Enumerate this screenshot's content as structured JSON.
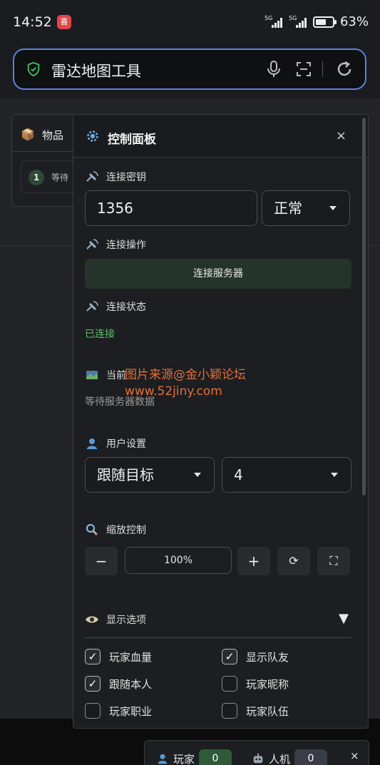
{
  "status_bar": {
    "time": "14:52",
    "notification_badge": "喜",
    "signal_1": "5G",
    "signal_2": "5G",
    "battery": "63%",
    "battery_level": 0.63
  },
  "browser": {
    "search_text": "雷达地图工具"
  },
  "items_panel": {
    "title": "物品",
    "row_number": "1",
    "row_text": "等待"
  },
  "control_panel": {
    "title": "控制面板",
    "close": "×",
    "connection_key": {
      "label": "连接密钥",
      "value": "1356",
      "mode": "正常"
    },
    "connection_action": {
      "label": "连接操作",
      "button": "连接服务器"
    },
    "connection_status": {
      "label": "连接状态",
      "value": "已连接"
    },
    "current": {
      "label": "当前",
      "value": "等待服务器数据"
    },
    "watermark": {
      "line1": "图片来源@金小颖论坛",
      "line2": "www.52jiny.com"
    },
    "user_settings": {
      "label": "用户设置",
      "follow": "跟随目标",
      "number": "4"
    },
    "zoom": {
      "label": "缩放控制",
      "minus": "−",
      "value": "100%",
      "plus": "+",
      "reset": "⟳",
      "fullscreen": "⛶"
    },
    "display_options": {
      "label": "显示选项",
      "toggle": "▼",
      "options": [
        {
          "label": "玩家血量",
          "checked": true
        },
        {
          "label": "显示队友",
          "checked": true
        },
        {
          "label": "跟随本人",
          "checked": true
        },
        {
          "label": "玩家昵称",
          "checked": false
        },
        {
          "label": "玩家职业",
          "checked": false
        },
        {
          "label": "玩家队伍",
          "checked": false
        }
      ]
    }
  },
  "mini_bar": {
    "player_label": "玩家",
    "player_count": "0",
    "bot_label": "人机",
    "bot_count": "0",
    "close": "×"
  },
  "colors": {
    "accent_green": "#5fbf6a",
    "search_border": "#5a82d8",
    "watermark": "#e0703a"
  }
}
